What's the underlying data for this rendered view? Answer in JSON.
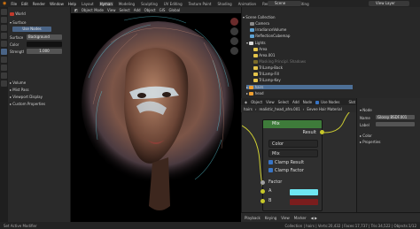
{
  "menu": [
    "File",
    "Edit",
    "Render",
    "Window",
    "Help"
  ],
  "workspaces": [
    "Layout",
    "Hyman",
    "Modeling",
    "Sculpting",
    "UV Editing",
    "Texture Paint",
    "Shading",
    "Animation",
    "Rendering",
    "Compositing",
    "Scripting"
  ],
  "active_workspace": "Hyman",
  "scene_name": "Scene",
  "view_layer": "View Layer",
  "properties": {
    "world_name": "World",
    "surface_label": "Surface",
    "use_nodes": "Use Nodes",
    "surface_field_label": "Surface",
    "surface_value": "Background",
    "color_label": "Color",
    "strength_label": "Strength",
    "strength_value": "1.000",
    "sections": [
      "Volume",
      "Mist Pass",
      "Viewport Display",
      "Custom Properties"
    ]
  },
  "viewport": {
    "mode": "Object Mode",
    "menu": [
      "View",
      "Select",
      "Add",
      "Object",
      "GIS"
    ],
    "transform": "Global"
  },
  "outliner": {
    "root": "Scene Collection",
    "items": [
      "Camera",
      "IrradianceVolume",
      "ReflectionCubemap",
      "Lights",
      "Area",
      "Area.001",
      "Masking Principl. Shadows",
      "TriLamp-Back",
      "TriLamp-Fill",
      "TriLamp-Key",
      "hairs",
      "head"
    ]
  },
  "node_editor": {
    "header": [
      "Object",
      "View",
      "Select",
      "Add",
      "Node",
      "Use Nodes"
    ],
    "slot": "Slot 1",
    "material": "Eevee Hair Material",
    "breadcrumb": [
      "hairs",
      "realistic_head_afro.001",
      "Eevee Hair Material"
    ],
    "mix_node": {
      "title": "Mix",
      "output": "Result",
      "data_type": "Color",
      "blend_mode": "Mix",
      "clamp_result": "Clamp Result",
      "clamp_factor": "Clamp Factor",
      "factor_label": "Factor",
      "a_label": "A",
      "b_label": "B",
      "a_color": "#6ee7f2",
      "b_color": "#7a1d1d"
    }
  },
  "npanel": {
    "node_label": "Node",
    "name_label": "Name",
    "name_value": "Glossy BSDF.001",
    "label_label": "Label",
    "color_section": "Color",
    "properties_section": "Properties"
  },
  "timeline": [
    "Playback",
    "Keying",
    "View",
    "Marker"
  ],
  "status": {
    "left": "Set Active Modifier",
    "right": "Collection | hairs | Verts:20,432 | Faces:17,737 | Tris:34,522 | Objects:1/12"
  }
}
